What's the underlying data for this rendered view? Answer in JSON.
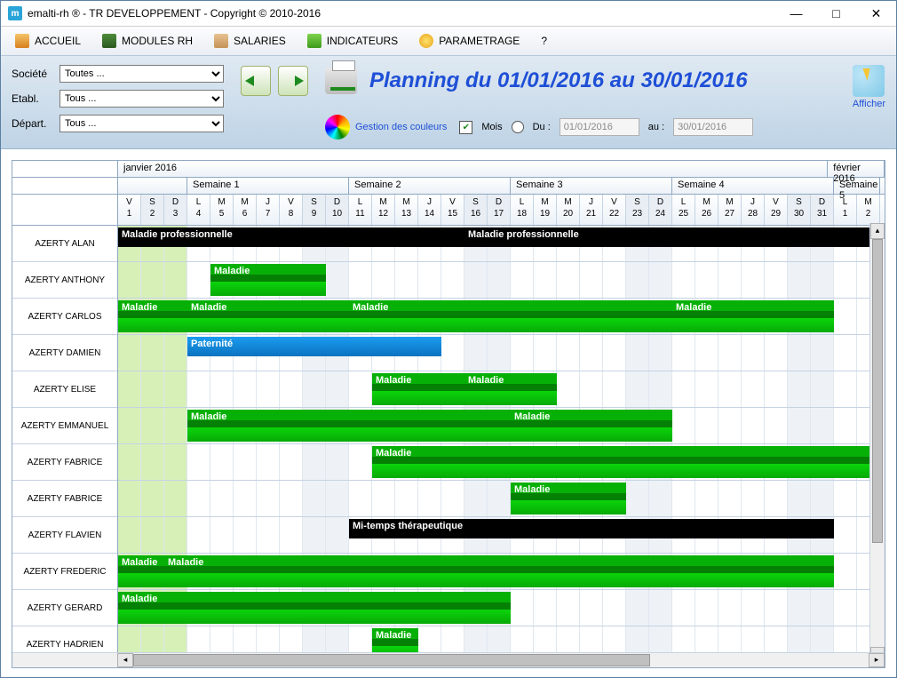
{
  "window": {
    "title": "emalti-rh ® - TR DEVELOPPEMENT - Copyright © 2010-2016",
    "icon_letter": "m"
  },
  "menu": {
    "accueil": "ACCUEIL",
    "modules": "MODULES RH",
    "salaries": "SALARIES",
    "indicateurs": "INDICATEURS",
    "parametrage": "PARAMETRAGE",
    "help": "?"
  },
  "filters": {
    "societe_label": "Société",
    "societe_value": "Toutes ...",
    "etabl_label": "Etabl.",
    "etabl_value": "Tous ...",
    "depart_label": "Départ.",
    "depart_value": "Tous ..."
  },
  "tools": {
    "gestion_couleurs": "Gestion des couleurs",
    "mois": "Mois",
    "du": "Du :",
    "au": "au :",
    "date_from": "01/01/2016",
    "date_to": "30/01/2016",
    "afficher": "Afficher"
  },
  "planning_title": "Planning du 01/01/2016 au 30/01/2016",
  "timeline": {
    "month_main": "janvier 2016",
    "month_next": "février 2016",
    "weeks": [
      "Semaine 1",
      "Semaine 2",
      "Semaine 3",
      "Semaine 4",
      "Semaine 5"
    ],
    "days": [
      {
        "d": "V",
        "n": "1",
        "w": false,
        "pre": true
      },
      {
        "d": "S",
        "n": "2",
        "w": true,
        "pre": true
      },
      {
        "d": "D",
        "n": "3",
        "w": true,
        "pre": true
      },
      {
        "d": "L",
        "n": "4",
        "w": false
      },
      {
        "d": "M",
        "n": "5",
        "w": false
      },
      {
        "d": "M",
        "n": "6",
        "w": false
      },
      {
        "d": "J",
        "n": "7",
        "w": false
      },
      {
        "d": "V",
        "n": "8",
        "w": false
      },
      {
        "d": "S",
        "n": "9",
        "w": true
      },
      {
        "d": "D",
        "n": "10",
        "w": true
      },
      {
        "d": "L",
        "n": "11",
        "w": false
      },
      {
        "d": "M",
        "n": "12",
        "w": false
      },
      {
        "d": "M",
        "n": "13",
        "w": false
      },
      {
        "d": "J",
        "n": "14",
        "w": false
      },
      {
        "d": "V",
        "n": "15",
        "w": false
      },
      {
        "d": "S",
        "n": "16",
        "w": true
      },
      {
        "d": "D",
        "n": "17",
        "w": true
      },
      {
        "d": "L",
        "n": "18",
        "w": false
      },
      {
        "d": "M",
        "n": "19",
        "w": false
      },
      {
        "d": "M",
        "n": "20",
        "w": false
      },
      {
        "d": "J",
        "n": "21",
        "w": false
      },
      {
        "d": "V",
        "n": "22",
        "w": false
      },
      {
        "d": "S",
        "n": "23",
        "w": true
      },
      {
        "d": "D",
        "n": "24",
        "w": true
      },
      {
        "d": "L",
        "n": "25",
        "w": false
      },
      {
        "d": "M",
        "n": "26",
        "w": false
      },
      {
        "d": "M",
        "n": "27",
        "w": false
      },
      {
        "d": "J",
        "n": "28",
        "w": false
      },
      {
        "d": "V",
        "n": "29",
        "w": false
      },
      {
        "d": "S",
        "n": "30",
        "w": true
      },
      {
        "d": "D",
        "n": "31",
        "w": true
      },
      {
        "d": "L",
        "n": "1",
        "w": false
      },
      {
        "d": "M",
        "n": "2",
        "w": false
      }
    ]
  },
  "employees": [
    {
      "name": "AZERTY ALAN",
      "bars": [
        {
          "label": "Maladie professionnelle",
          "cls": "bar-black",
          "from": 0,
          "to": 15
        },
        {
          "label": "Maladie professionnelle",
          "cls": "bar-black",
          "from": 15,
          "to": 33
        }
      ]
    },
    {
      "name": "AZERTY ANTHONY",
      "bars": [
        {
          "label": "Maladie",
          "cls": "bar-green-sh",
          "from": 4,
          "to": 9
        }
      ]
    },
    {
      "name": "AZERTY CARLOS",
      "bars": [
        {
          "label": "Maladie",
          "cls": "bar-green-sh",
          "from": 0,
          "to": 3
        },
        {
          "label": "Maladie",
          "cls": "bar-green-sh",
          "from": 3,
          "to": 10
        },
        {
          "label": "Maladie",
          "cls": "bar-green-sh",
          "from": 10,
          "to": 24
        },
        {
          "label": "Maladie",
          "cls": "bar-green-sh",
          "from": 24,
          "to": 31
        }
      ]
    },
    {
      "name": "AZERTY DAMIEN",
      "bars": [
        {
          "label": "Paternité",
          "cls": "bar-blue",
          "from": 3,
          "to": 14
        }
      ]
    },
    {
      "name": "AZERTY ELISE",
      "bars": [
        {
          "label": "Maladie",
          "cls": "bar-green-sh",
          "from": 11,
          "to": 15
        },
        {
          "label": "Maladie",
          "cls": "bar-green-sh",
          "from": 15,
          "to": 19
        }
      ]
    },
    {
      "name": "AZERTY EMMANUEL",
      "bars": [
        {
          "label": "Maladie",
          "cls": "bar-green-sh",
          "from": 3,
          "to": 17
        },
        {
          "label": "Maladie",
          "cls": "bar-green-sh",
          "from": 17,
          "to": 24
        }
      ]
    },
    {
      "name": "AZERTY FABRICE",
      "bars": [
        {
          "label": "Maladie",
          "cls": "bar-green-sh",
          "from": 11,
          "to": 33
        }
      ]
    },
    {
      "name": "AZERTY FABRICE",
      "bars": [
        {
          "label": "Maladie",
          "cls": "bar-green-sh",
          "from": 17,
          "to": 22
        }
      ]
    },
    {
      "name": "AZERTY FLAVIEN",
      "bars": [
        {
          "label": "Mi-temps thérapeutique",
          "cls": "bar-black",
          "from": 10,
          "to": 31
        }
      ]
    },
    {
      "name": "AZERTY FREDERIC",
      "bars": [
        {
          "label": "Maladie",
          "cls": "bar-green-sh",
          "from": 0,
          "to": 2
        },
        {
          "label": "Maladie",
          "cls": "bar-green-sh",
          "from": 2,
          "to": 31
        }
      ]
    },
    {
      "name": "AZERTY GERARD",
      "bars": [
        {
          "label": "Maladie",
          "cls": "bar-green-sh",
          "from": 0,
          "to": 17
        }
      ]
    },
    {
      "name": "AZERTY HADRIEN",
      "bars": [
        {
          "label": "Maladie",
          "cls": "bar-green-sh",
          "from": 11,
          "to": 13
        }
      ]
    }
  ]
}
